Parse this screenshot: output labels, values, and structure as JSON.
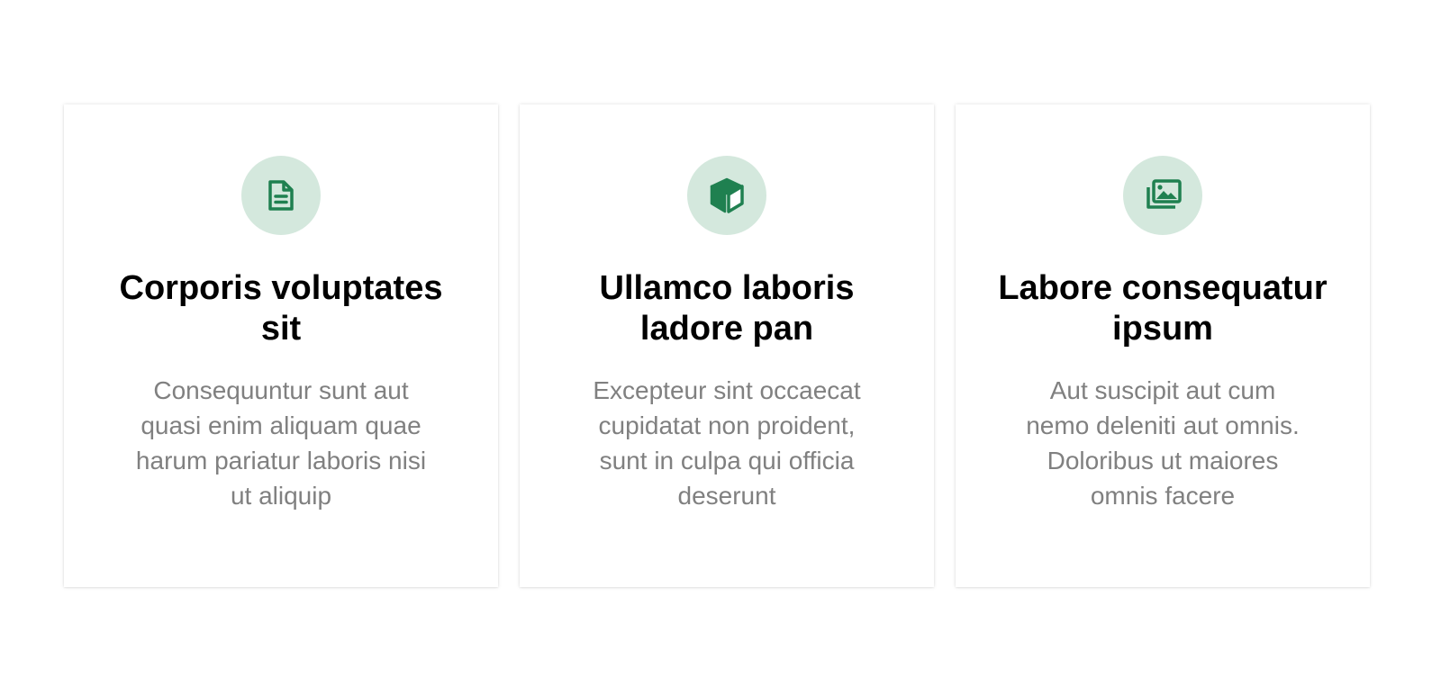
{
  "colors": {
    "accent": "#1f8050",
    "icon_bg": "#d4e8dd",
    "title": "#000000",
    "body_text": "#808080"
  },
  "cards": [
    {
      "icon": "document-icon",
      "title_line1": "Corporis voluptates",
      "title_line2": "sit",
      "text_lines": [
        "Consequuntur sunt aut",
        "quasi enim aliquam quae",
        "harum pariatur laboris nisi",
        "ut aliquip"
      ]
    },
    {
      "icon": "box-icon",
      "title_line1": "Ullamco laboris",
      "title_line2": "ladore pan",
      "text_lines": [
        "Excepteur sint occaecat",
        "cupidatat non proident,",
        "sunt in culpa qui officia",
        "deserunt"
      ]
    },
    {
      "icon": "images-icon",
      "title_line1": "Labore consequatur",
      "title_line2": "ipsum",
      "text_lines": [
        "Aut suscipit aut cum",
        "nemo deleniti aut omnis.",
        "Doloribus ut maiores",
        "omnis facere"
      ]
    }
  ]
}
